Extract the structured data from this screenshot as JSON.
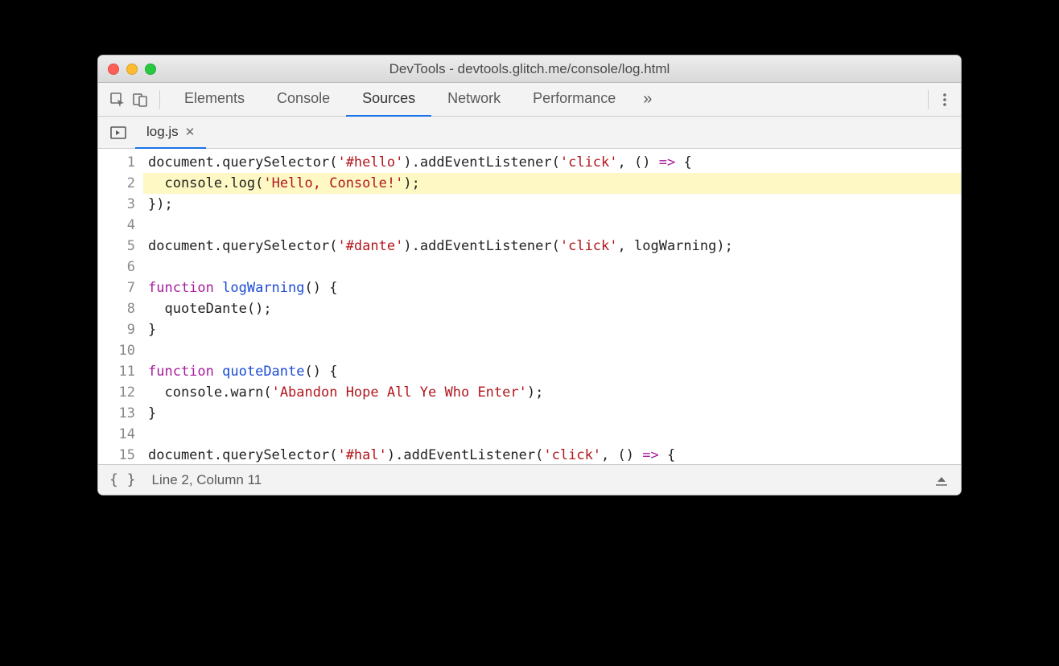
{
  "window": {
    "title": "DevTools - devtools.glitch.me/console/log.html"
  },
  "toolbar": {
    "tabs": [
      "Elements",
      "Console",
      "Sources",
      "Network",
      "Performance"
    ],
    "activeTab": "Sources",
    "overflow": "»"
  },
  "fileTabs": {
    "active": "log.js"
  },
  "editor": {
    "highlightedLine": 2,
    "lines": [
      {
        "n": 1,
        "tokens": [
          {
            "t": "document",
            "c": "tk-id"
          },
          {
            "t": ".",
            "c": "tk-id"
          },
          {
            "t": "querySelector",
            "c": "tk-id"
          },
          {
            "t": "(",
            "c": "tk-par"
          },
          {
            "t": "'#hello'",
            "c": "tk-str"
          },
          {
            "t": ")",
            "c": "tk-par"
          },
          {
            "t": ".",
            "c": "tk-id"
          },
          {
            "t": "addEventListener",
            "c": "tk-id"
          },
          {
            "t": "(",
            "c": "tk-par"
          },
          {
            "t": "'click'",
            "c": "tk-str"
          },
          {
            "t": ", ",
            "c": "tk-id"
          },
          {
            "t": "()",
            "c": "tk-par"
          },
          {
            "t": " ",
            "c": "tk-id"
          },
          {
            "t": "=>",
            "c": "tk-arrow"
          },
          {
            "t": " ",
            "c": "tk-id"
          },
          {
            "t": "{",
            "c": "tk-par"
          }
        ]
      },
      {
        "n": 2,
        "tokens": [
          {
            "t": "  console",
            "c": "tk-id"
          },
          {
            "t": ".",
            "c": "tk-id"
          },
          {
            "t": "log",
            "c": "tk-id"
          },
          {
            "t": "(",
            "c": "tk-par"
          },
          {
            "t": "'Hello, Console!'",
            "c": "tk-str"
          },
          {
            "t": ")",
            "c": "tk-par"
          },
          {
            "t": ";",
            "c": "tk-id"
          }
        ]
      },
      {
        "n": 3,
        "tokens": [
          {
            "t": "}",
            "c": "tk-par"
          },
          {
            "t": ")",
            "c": "tk-par"
          },
          {
            "t": ";",
            "c": "tk-id"
          }
        ]
      },
      {
        "n": 4,
        "tokens": []
      },
      {
        "n": 5,
        "tokens": [
          {
            "t": "document",
            "c": "tk-id"
          },
          {
            "t": ".",
            "c": "tk-id"
          },
          {
            "t": "querySelector",
            "c": "tk-id"
          },
          {
            "t": "(",
            "c": "tk-par"
          },
          {
            "t": "'#dante'",
            "c": "tk-str"
          },
          {
            "t": ")",
            "c": "tk-par"
          },
          {
            "t": ".",
            "c": "tk-id"
          },
          {
            "t": "addEventListener",
            "c": "tk-id"
          },
          {
            "t": "(",
            "c": "tk-par"
          },
          {
            "t": "'click'",
            "c": "tk-str"
          },
          {
            "t": ", ",
            "c": "tk-id"
          },
          {
            "t": "logWarning",
            "c": "tk-id"
          },
          {
            "t": ")",
            "c": "tk-par"
          },
          {
            "t": ";",
            "c": "tk-id"
          }
        ]
      },
      {
        "n": 6,
        "tokens": []
      },
      {
        "n": 7,
        "tokens": [
          {
            "t": "function",
            "c": "tk-kw"
          },
          {
            "t": " ",
            "c": "tk-id"
          },
          {
            "t": "logWarning",
            "c": "tk-fn"
          },
          {
            "t": "()",
            "c": "tk-par"
          },
          {
            "t": " ",
            "c": "tk-id"
          },
          {
            "t": "{",
            "c": "tk-par"
          }
        ]
      },
      {
        "n": 8,
        "tokens": [
          {
            "t": "  quoteDante",
            "c": "tk-id"
          },
          {
            "t": "()",
            "c": "tk-par"
          },
          {
            "t": ";",
            "c": "tk-id"
          }
        ]
      },
      {
        "n": 9,
        "tokens": [
          {
            "t": "}",
            "c": "tk-par"
          }
        ]
      },
      {
        "n": 10,
        "tokens": []
      },
      {
        "n": 11,
        "tokens": [
          {
            "t": "function",
            "c": "tk-kw"
          },
          {
            "t": " ",
            "c": "tk-id"
          },
          {
            "t": "quoteDante",
            "c": "tk-fn"
          },
          {
            "t": "()",
            "c": "tk-par"
          },
          {
            "t": " ",
            "c": "tk-id"
          },
          {
            "t": "{",
            "c": "tk-par"
          }
        ]
      },
      {
        "n": 12,
        "tokens": [
          {
            "t": "  console",
            "c": "tk-id"
          },
          {
            "t": ".",
            "c": "tk-id"
          },
          {
            "t": "warn",
            "c": "tk-id"
          },
          {
            "t": "(",
            "c": "tk-par"
          },
          {
            "t": "'Abandon Hope All Ye Who Enter'",
            "c": "tk-str"
          },
          {
            "t": ")",
            "c": "tk-par"
          },
          {
            "t": ";",
            "c": "tk-id"
          }
        ]
      },
      {
        "n": 13,
        "tokens": [
          {
            "t": "}",
            "c": "tk-par"
          }
        ]
      },
      {
        "n": 14,
        "tokens": []
      },
      {
        "n": 15,
        "tokens": [
          {
            "t": "document",
            "c": "tk-id"
          },
          {
            "t": ".",
            "c": "tk-id"
          },
          {
            "t": "querySelector",
            "c": "tk-id"
          },
          {
            "t": "(",
            "c": "tk-par"
          },
          {
            "t": "'#hal'",
            "c": "tk-str"
          },
          {
            "t": ")",
            "c": "tk-par"
          },
          {
            "t": ".",
            "c": "tk-id"
          },
          {
            "t": "addEventListener",
            "c": "tk-id"
          },
          {
            "t": "(",
            "c": "tk-par"
          },
          {
            "t": "'click'",
            "c": "tk-str"
          },
          {
            "t": ", ",
            "c": "tk-id"
          },
          {
            "t": "()",
            "c": "tk-par"
          },
          {
            "t": " ",
            "c": "tk-id"
          },
          {
            "t": "=>",
            "c": "tk-arrow"
          },
          {
            "t": " ",
            "c": "tk-id"
          },
          {
            "t": "{",
            "c": "tk-par"
          }
        ]
      }
    ]
  },
  "status": {
    "braces": "{ }",
    "position": "Line 2, Column 11"
  }
}
